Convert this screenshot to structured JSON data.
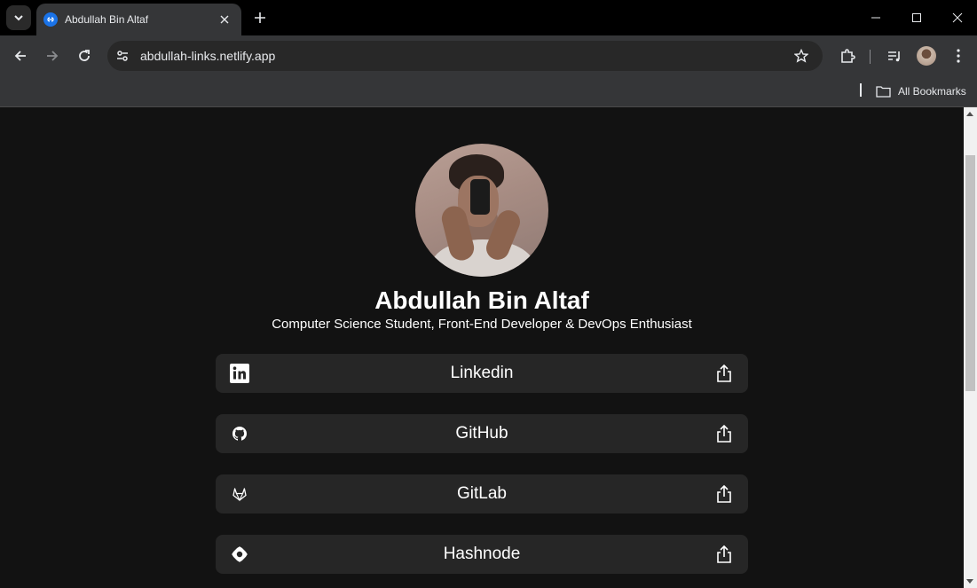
{
  "browser": {
    "tab_title": "Abdullah Bin Altaf",
    "url": "abdullah-links.netlify.app",
    "bookmarks_label": "All Bookmarks"
  },
  "profile": {
    "name": "Abdullah Bin Altaf",
    "tagline": "Computer Science Student, Front-End Developer & DevOps Enthusiast"
  },
  "links": [
    {
      "label": "Linkedin",
      "icon": "linkedin-icon"
    },
    {
      "label": "GitHub",
      "icon": "github-icon"
    },
    {
      "label": "GitLab",
      "icon": "gitlab-icon"
    },
    {
      "label": "Hashnode",
      "icon": "hashnode-icon"
    }
  ],
  "colors": {
    "page_bg": "#121212",
    "card_bg": "#262626",
    "browser_chrome": "#353638",
    "accent": "#1a73e8"
  }
}
